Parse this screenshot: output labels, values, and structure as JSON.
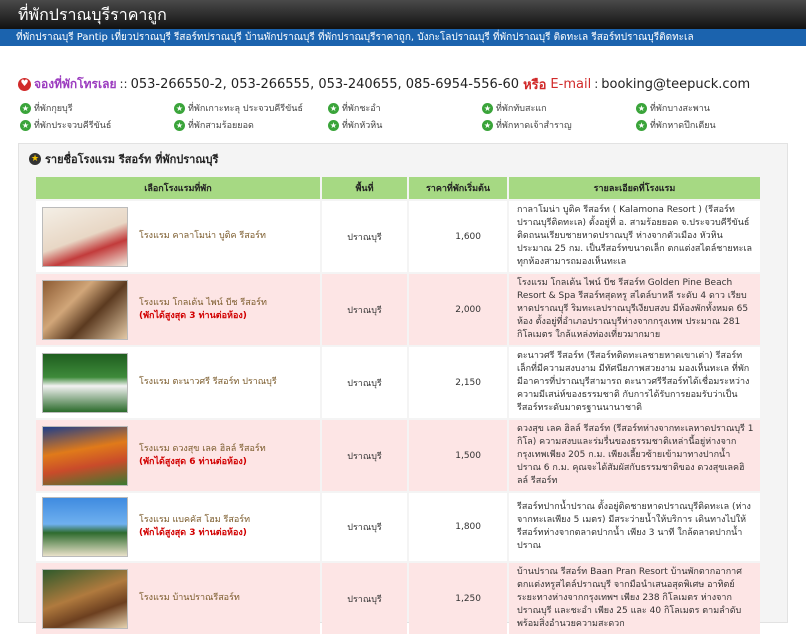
{
  "header": {
    "title": "ที่พักปราณบุรีราคาถูก"
  },
  "keyword_bar": {
    "text": "ที่พักปราณบุรี Pantip เที่ยวปราณบุรี รีสอร์ทปราณบุรี บ้านพักปราณบุรี ที่พักปราณบุรีราคาถูก, บังกะโลปราณบุรี ที่พักปราณบุรี ติดทะเล รีสอร์ทปราณบุรีติดทะเล"
  },
  "contact": {
    "booking_label": "จองที่พักโทรเลย",
    "separator": "::",
    "phones": "053-266550-2, 053-266555, 053-240655, 085-6954-556-60",
    "or_label": "หรือ",
    "email_label": "E-mail",
    "email_separator": ":",
    "email": "booking@teepuck.com"
  },
  "quick_links": [
    "ที่พักกุยบุรี",
    "ที่พักเกาะทะลุ ประจวบคีรีขันธ์",
    "ที่พักชะอำ",
    "ที่พักทับสะแก",
    "ที่พักบางสะพาน",
    "ที่พักประจวบคีรีขันธ์",
    "ที่พักสามร้อยยอด",
    "ที่พักหัวหิน",
    "ที่พักหาดเจ้าสำราญ",
    "ที่พักหาดปึกเตียน"
  ],
  "panel": {
    "title": "รายชื่อโรงแรม รีสอร์ท ที่พักปราณบุรี"
  },
  "table": {
    "headers": {
      "hotel": "เลือกโรงแรมที่พัก",
      "area": "พื้นที่",
      "price": "ราคาที่พักเริ่มต้น",
      "detail": "รายละเอียดที่โรงแรม"
    },
    "rows": [
      {
        "name": "โรงแรม คาลาโมน่า บูติค รีสอร์ท",
        "promo": "",
        "area": "ปราณบุรี",
        "price": "1,600",
        "desc": "กาลาโมน่า บูติค รีสอร์ท ( Kalamona Resort ) (รีสอร์ทปราณบุรีติดทะเล) ตั้งอยู่ที่ อ. สามร้อยยอด จ.ประจวบคีรีขันธ์ ติดถนนเรียบชายหาดปราณบุรี ห่างจากตัวเมือง หัวหินประมาณ 25 กม. เป็นรีสอร์ทขนาดเล็ก ตกแต่งสไตล์ชายทะเล ทุกห้องสามารถมองเห็นทะเล"
      },
      {
        "name": "โรงแรม โกลเด้น ไพน์ บีช รีสอร์ท",
        "promo": "(พักได้สูงสุด 3 ท่านต่อห้อง)",
        "area": "ปราณบุรี",
        "price": "2,000",
        "desc": "โรงแรม โกลเด้น ไพน์ บีช รีสอร์ท Golden Pine Beach Resort & Spa รีสอร์ทสุดหรู สไตล์บาหลี ระดับ 4 ดาว เรียบหาดปราณบุรี ริมทะเลปราณบุรีเงียบสงบ มีห้องพักทั้งหมด 65 ห้อง ตั้งอยู่ที่อำเภอปราณบุรีห่างจากกรุงเทพ ประมาณ 281 กิโลเมตร ใกล้แหล่งท่องเที่ยวมากมาย"
      },
      {
        "name": "โรงแรม ตะนาวศรี รีสอร์ท ปราณบุรี",
        "promo": "",
        "area": "ปราณบุรี",
        "price": "2,150",
        "desc": "ตะนาวศรี รีสอร์ท (รีสอร์ทติดทะเลชายหาดเขาเต่า) รีสอร์ทเล็กที่มีความสงบงาม มีทัศนียภาพสวยงาม มองเห็นทะเล ที่พักมีอาคารที่ปราณบุรีสามารถ ตะนาวศรีรีสอร์ทได้เชื่อมระหว่างความมีเสน่ห์ของธรรมชาติ กับการได้รับการยอมรับว่าเป็นรีสอร์ทระดับมาตรฐานนานาชาติ"
      },
      {
        "name": "โรงแรม ดวงสุข เลค ฮิลล์ รีสอร์ท",
        "promo": "(พักได้สูงสุด 6 ท่านต่อห้อง)",
        "area": "ปราณบุรี",
        "price": "1,500",
        "desc": "ดวงสุข เลค ฮิลล์ รีสอร์ท (รีสอร์ทห่างจากทะเลหาดปราณบุรี 1 กิโล) ความสงบและร่มรื่นของธรรมชาติเหล่านี้อยู่ห่างจากกรุงเทพเพียง 205 ก.ม. เพียงเลี้ยวซ้ายเข้ามาทางปากน้ำปราณ 6 ก.ม. คุณจะได้สัมผัสกับธรรมชาติของ ดวงสุขเลคฮิลล์ รีสอร์ท"
      },
      {
        "name": "โรงแรม แบคคัส โฮม รีสอร์ท",
        "promo": "(พักได้สูงสุด 3 ท่านต่อห้อง)",
        "area": "ปราณบุรี",
        "price": "1,800",
        "desc": "รีสอร์ทปากน้ำปราณ ตั้งอยู่ติดชายหาดปราณบุรีติดทะเล (ห่างจากทะเลเพียง 5 เมตร) มีสระว่ายน้ำให้บริการ เดินทางไปให้รีสอร์ทห่างจากตลาดปากน้ำ เพียง 3 นาที ใกล้ตลาดปากน้ำปราณ"
      },
      {
        "name": "โรงแรม บ้านปราณรีสอร์ท",
        "promo": "",
        "area": "ปราณบุรี",
        "price": "1,250",
        "desc": "บ้านปราณ รีสอร์ท Baan Pran Resort บ้านพักตากอากาศ ตกแต่งหรูสไตล์ปราณบุรี จากมือนำเสนอสุดพิเศษ อาทิตย์ ระยะทางห่างจากกรุงเทพฯ เพียง 238 กิโลเมตร ห่างจากปราณบุรี และชะอำ เพียง 25 และ 40 กิโลเมตร ตามลำดับ พร้อมสิ่งอำนวยความสะดวก"
      }
    ]
  }
}
